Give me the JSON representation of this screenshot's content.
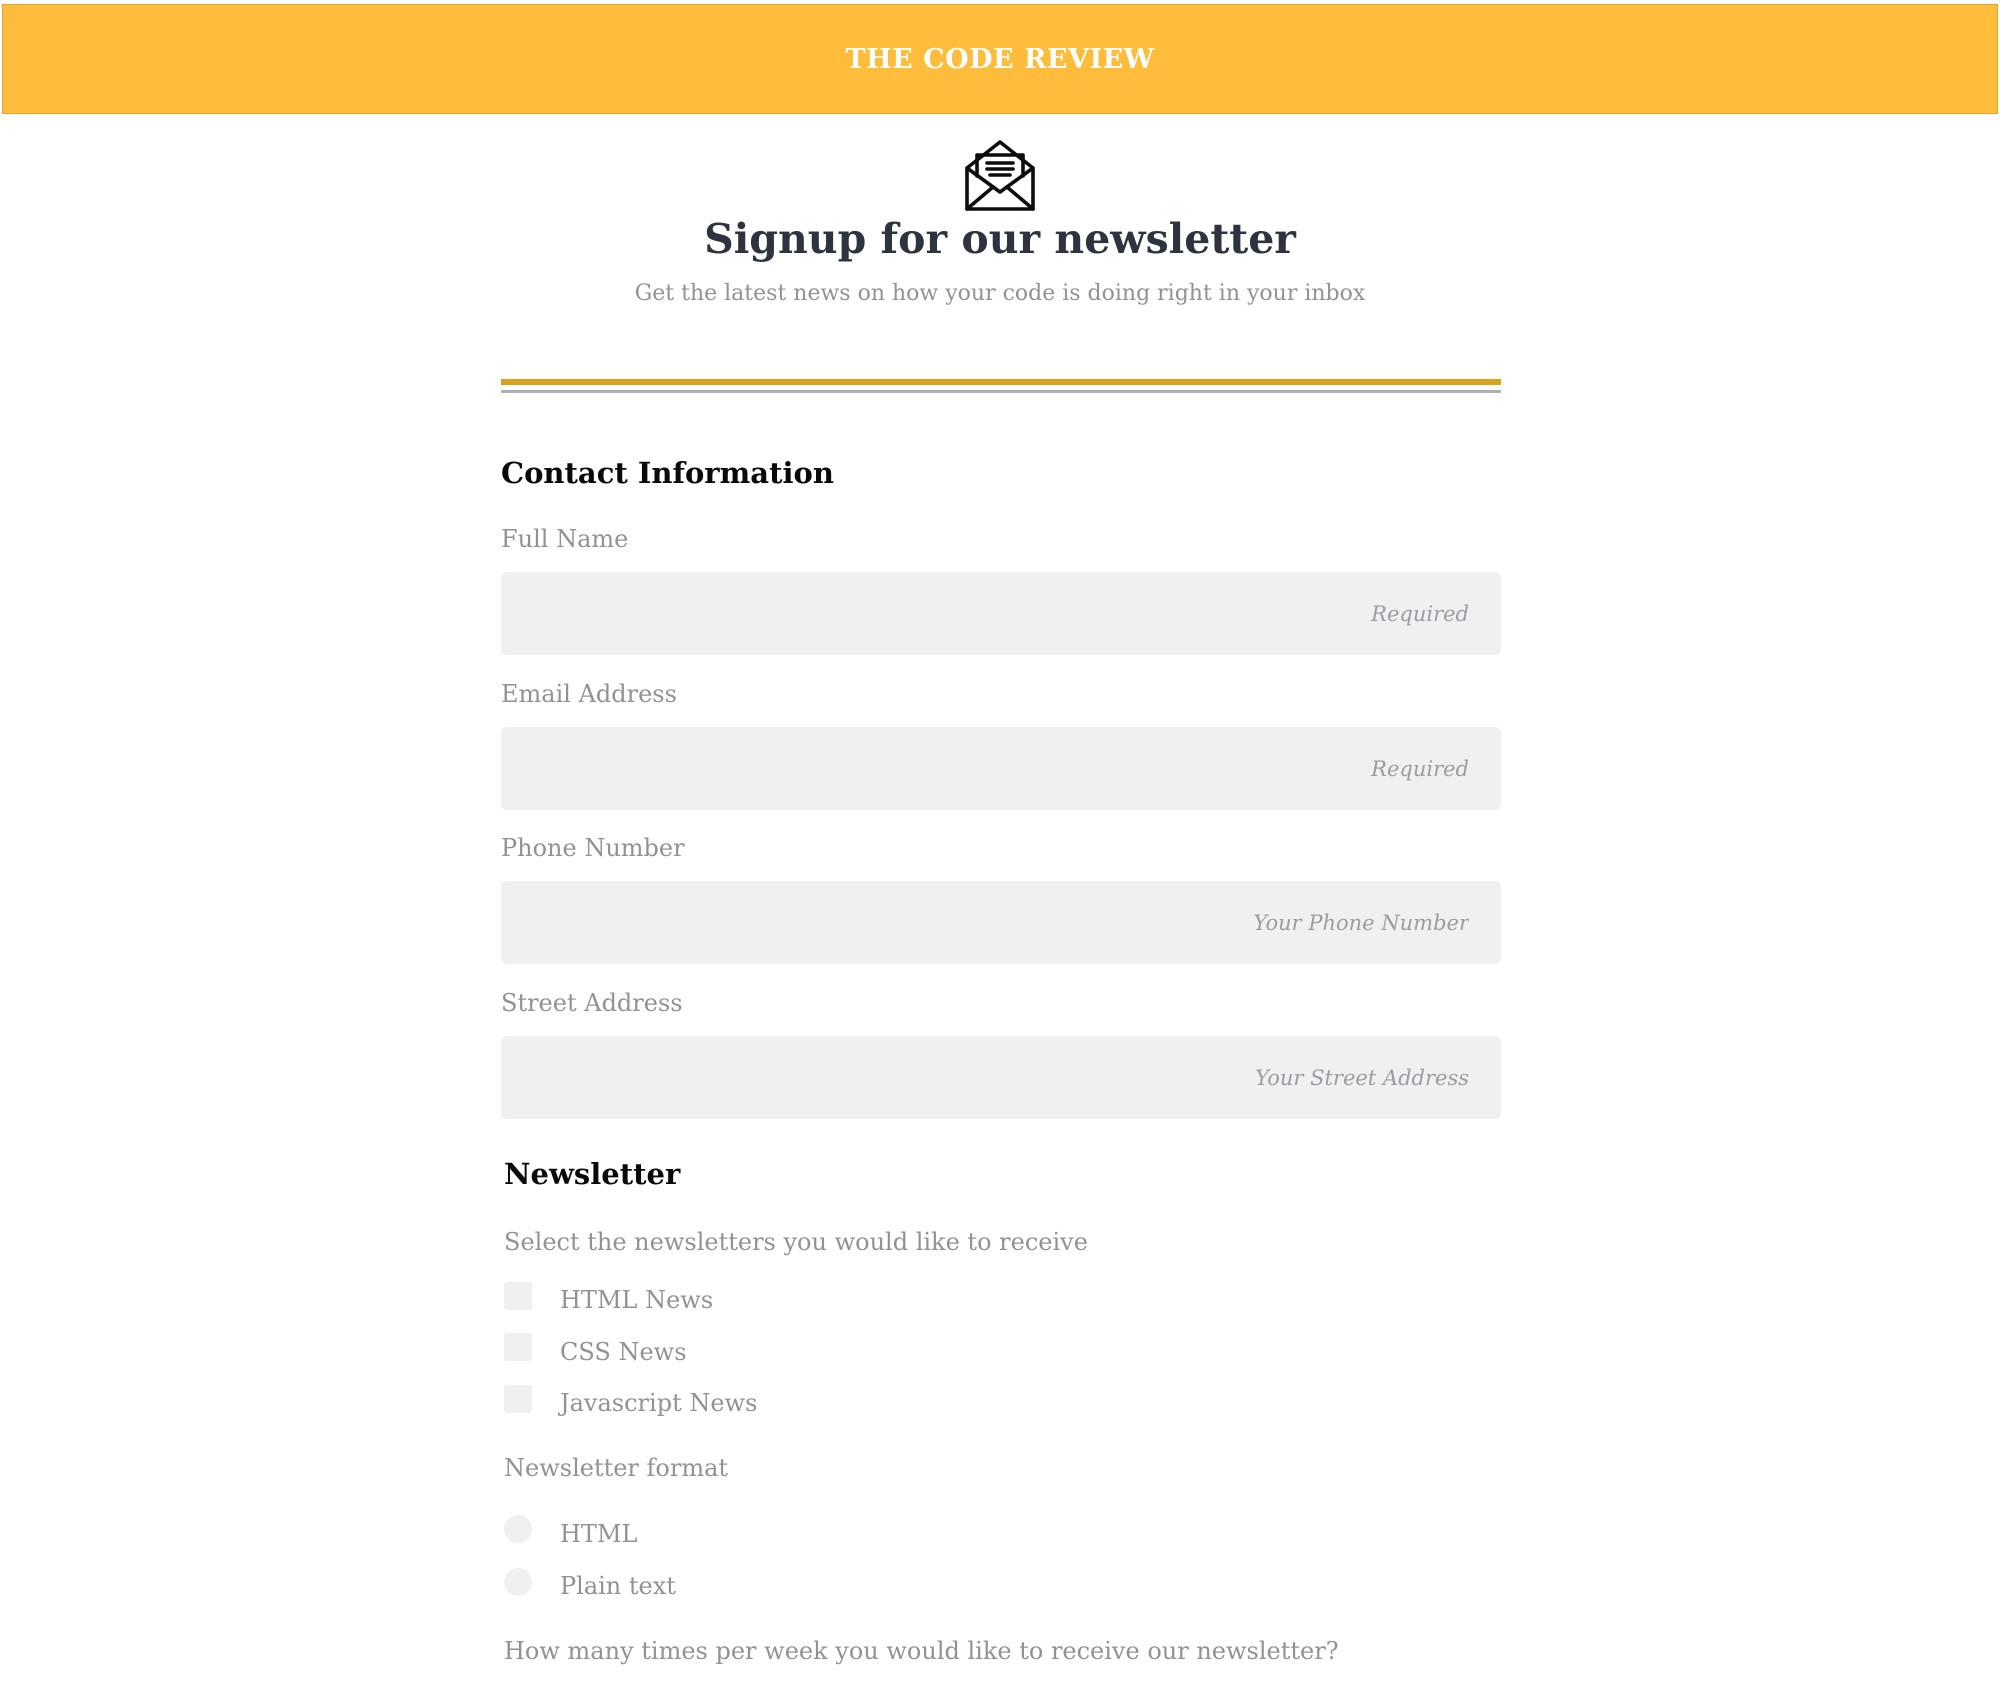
{
  "header": {
    "brand": "THE CODE REVIEW",
    "background_color": "#ffbd3b"
  },
  "hero": {
    "icon": "open-envelope-icon",
    "title": "Signup for our newsletter",
    "subtitle": "Get the latest news on how your code is doing right in your inbox"
  },
  "contact": {
    "heading": "Contact Information",
    "full_name": {
      "label": "Full Name",
      "placeholder": "Required",
      "value": ""
    },
    "email": {
      "label": "Email Address",
      "placeholder": "Required",
      "value": ""
    },
    "phone": {
      "label": "Phone Number",
      "placeholder": "Your Phone Number",
      "value": ""
    },
    "street": {
      "label": "Street Address",
      "placeholder": "Your Street Address",
      "value": ""
    }
  },
  "newsletter": {
    "heading": "Newsletter",
    "select_prompt": "Select the newsletters you would like to receive",
    "options": [
      {
        "label": "HTML News",
        "checked": false
      },
      {
        "label": "CSS News",
        "checked": false
      },
      {
        "label": "Javascript News",
        "checked": false
      }
    ],
    "format_prompt": "Newsletter format",
    "formats": [
      {
        "label": "HTML",
        "selected": false
      },
      {
        "label": "Plain text",
        "selected": false
      }
    ],
    "frequency_prompt": "How many times per week you would like to receive our newsletter?"
  },
  "colors": {
    "accent_gold": "#d9a21f",
    "divider_gray": "#aeb0b3",
    "input_background": "#eff0f1",
    "label_gray": "#8f9296",
    "title_dark": "#2d3440"
  }
}
